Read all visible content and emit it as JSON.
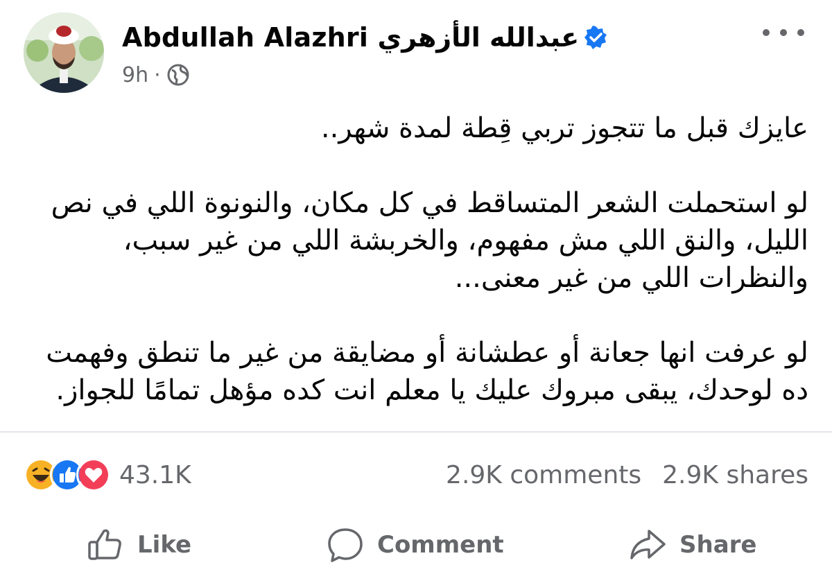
{
  "post": {
    "author_name": "Abdullah Alazhri  عبدالله الأزهري",
    "time": "9h",
    "separator": "·",
    "audience_icon": "globe-icon",
    "verified_icon": "verified-badge-icon",
    "more_icon": "more-options-icon",
    "paragraphs": [
      "عايزك قبل ما تتجوز تربي قِطة لمدة شهر..",
      "لو استحملت الشعر المتساقط في كل مكان، والنونوة اللي في نص الليل، والنق اللي مش مفهوم، والخربشة اللي من غير سبب، والنظرات اللي من غير معنى...",
      "لو عرفت انها جعانة أو عطشانة أو مضايقة من غير ما تنطق وفهمت ده لوحدك، يبقى مبروك عليك يا معلم انت كده مؤهل تمامًا للجواز."
    ]
  },
  "stats": {
    "reactions_count": "43.1K",
    "reaction_icons": [
      "haha-icon",
      "like-icon",
      "love-icon"
    ],
    "comments": "2.9K comments",
    "shares": "2.9K shares"
  },
  "actions": {
    "like": "Like",
    "comment": "Comment",
    "share": "Share"
  },
  "colors": {
    "text": "#050505",
    "secondary": "#65676b",
    "brand_blue": "#1877f2",
    "love_red": "#f33e58",
    "haha_yellow": "#f7b125"
  }
}
